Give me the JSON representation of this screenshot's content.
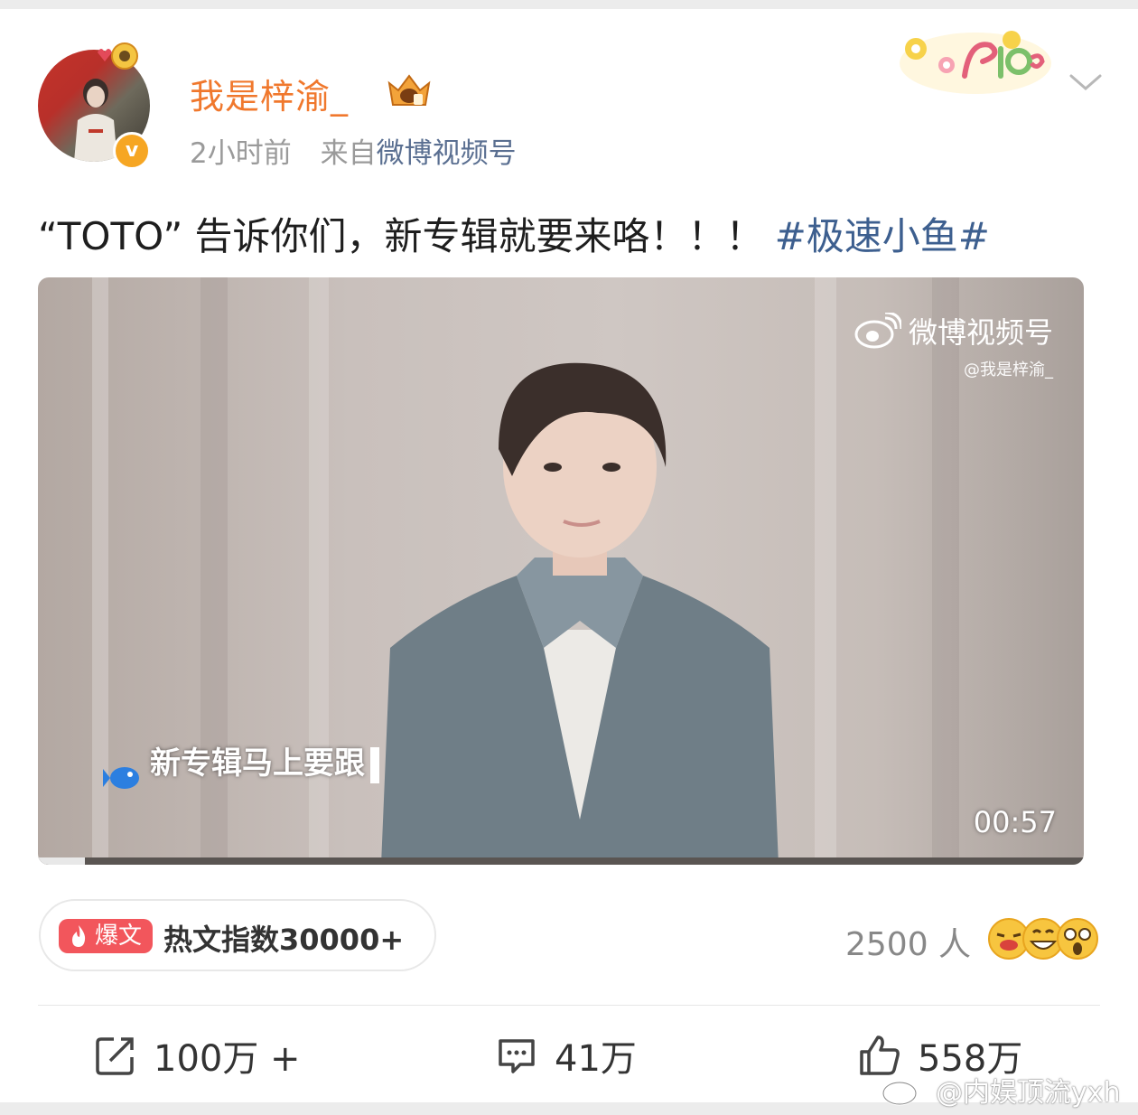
{
  "post": {
    "author": "我是梓渝_",
    "time": "2小时前",
    "source_prefix": "来自",
    "source": "微博视频号",
    "text": "“TOTO” 告诉你们，新专辑就要来咯！！！",
    "hashtag": "#极速小鱼#"
  },
  "video": {
    "watermark_brand": "微博视频号",
    "watermark_user": "@我是梓渝_",
    "subtitle": "新专辑马上要跟",
    "duration": "00:57",
    "progress": 0.045
  },
  "hot": {
    "badge": "爆文",
    "label": "热文指数30000+"
  },
  "reactions": {
    "count": "2500 人"
  },
  "actions": {
    "repost": "100万 +",
    "comment": "41万",
    "like": "558万"
  },
  "watermark": {
    "text": "@内娱顶流yxh"
  },
  "colors": {
    "username": "#f0782d",
    "hashtag": "#3d5f8f",
    "hot_badge": "#f2565c"
  },
  "icons": [
    "verified-icon",
    "vip-crown-icon",
    "plog-sticker",
    "chevron-down-icon",
    "weibo-logo-icon",
    "fish-icon",
    "flame-icon",
    "repost-icon",
    "comment-icon",
    "like-icon",
    "emoji-icon"
  ]
}
